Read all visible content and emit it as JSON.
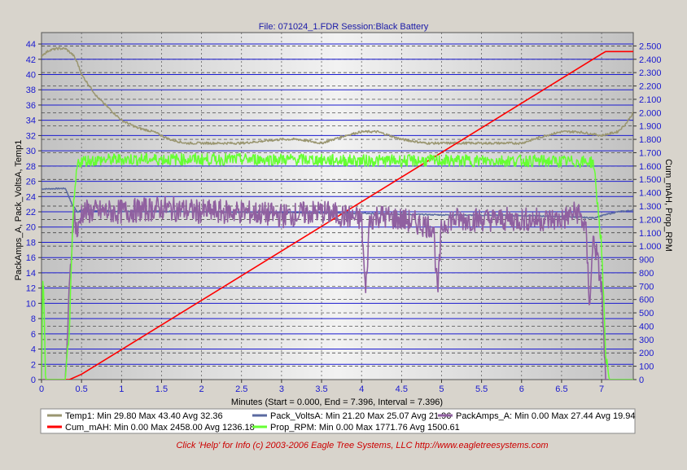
{
  "chart_data": {
    "type": "line",
    "title": "File: 071024_1.FDR   Session:Black Battery",
    "xlabel": "Minutes (Start = 0.000,  End = 7.396,  Interval =  7.396)",
    "ylabel_left": "PackAmps_A, Pack_VoltsA, Temp1",
    "ylabel_right": "Cum_mAH, Prop_RPM",
    "xlim": [
      0,
      7.396
    ],
    "ylim_left": [
      0,
      45.5
    ],
    "ylim_right": [
      0,
      2600
    ],
    "x_ticks": [
      "0",
      "0.5",
      "1",
      "1.5",
      "2",
      "2.5",
      "3",
      "3.5",
      "4",
      "4.5",
      "5",
      "5.5",
      "6",
      "6.5",
      "7"
    ],
    "y_left_ticks": [
      "0",
      "2",
      "4",
      "6",
      "8",
      "10",
      "12",
      "14",
      "16",
      "18",
      "20",
      "22",
      "24",
      "26",
      "28",
      "30",
      "32",
      "34",
      "36",
      "38",
      "40",
      "42",
      "44"
    ],
    "y_right_ticks": [
      "0",
      "100",
      "200",
      "300",
      "400",
      "500",
      "600",
      "700",
      "800",
      "900",
      "1.000",
      "1.100",
      "1.200",
      "1.300",
      "1.400",
      "1.500",
      "1.600",
      "1.700",
      "1.800",
      "1.900",
      "2.000",
      "2.100",
      "2.200",
      "2.300",
      "2.400",
      "2.500"
    ],
    "series": [
      {
        "name": "Temp1",
        "axis": "left",
        "color": "#9a9670",
        "legend": "Temp1:  Min 29.80 Max 43.40 Avg 32.36",
        "x": [
          0,
          0.1,
          0.2,
          0.3,
          0.4,
          0.45,
          0.5,
          0.6,
          0.7,
          0.8,
          0.9,
          1.0,
          1.1,
          1.2,
          1.4,
          1.6,
          1.8,
          2.0,
          2.5,
          3.0,
          3.2,
          3.5,
          3.8,
          4.0,
          4.2,
          4.5,
          4.8,
          5.0,
          5.5,
          6.0,
          6.3,
          6.5,
          6.7,
          7.0,
          7.2,
          7.3,
          7.396
        ],
        "y": [
          42.5,
          43.2,
          43.4,
          43.4,
          42.5,
          41.5,
          40.0,
          38.5,
          37.0,
          36.0,
          35.0,
          34.0,
          33.5,
          33.0,
          32.5,
          31.5,
          31.0,
          31.0,
          31.0,
          31.5,
          31.5,
          31.0,
          32.0,
          32.5,
          32.5,
          31.5,
          31.0,
          31.0,
          31.0,
          31.0,
          32.0,
          32.5,
          32.5,
          32.0,
          32.5,
          33.5,
          35.0
        ]
      },
      {
        "name": "Pack_VoltsA",
        "axis": "left",
        "color": "#5a6aa0",
        "legend": "Pack_VoltsA:  Min 21.20 Max 25.07 Avg 21.96",
        "x": [
          0,
          0.3,
          0.38,
          0.45,
          0.5,
          1.0,
          2.0,
          3.0,
          4.0,
          5.0,
          6.0,
          6.5,
          6.9,
          7.0,
          7.2,
          7.396
        ],
        "y": [
          25.0,
          25.07,
          23.0,
          22.0,
          22.2,
          22.1,
          22.0,
          21.9,
          21.8,
          21.6,
          21.5,
          21.4,
          21.2,
          21.5,
          22.0,
          22.2
        ]
      },
      {
        "name": "PackAmps_A",
        "axis": "left",
        "color": "#9060a0",
        "legend": "PackAmps_A:  Min 0.00 Max 27.44 Avg 19.94",
        "x": [
          0,
          0.3,
          0.35,
          0.4,
          0.45,
          0.5,
          1.0,
          1.5,
          2.0,
          2.5,
          3.0,
          3.5,
          4.0,
          4.05,
          4.1,
          4.2,
          4.5,
          4.9,
          4.95,
          5.0,
          5.1,
          5.5,
          6.0,
          6.5,
          6.7,
          6.8,
          6.85,
          6.9,
          7.0,
          7.05,
          7.396
        ],
        "y": [
          0,
          0,
          12,
          22,
          19,
          22,
          22,
          22.5,
          22,
          22,
          21.5,
          22,
          21,
          11,
          21,
          21.5,
          21,
          20,
          11,
          20,
          21,
          21,
          21,
          21,
          22,
          20,
          10,
          19,
          12,
          0,
          0
        ]
      },
      {
        "name": "Cum_mAH",
        "axis": "right",
        "color": "#ff0000",
        "legend": "Cum_mAH:  Min 0.00 Max 2458.00 Avg 1236.18",
        "x": [
          0,
          0.35,
          0.5,
          7.0,
          7.05,
          7.396
        ],
        "y": [
          0,
          0,
          40,
          2440,
          2458,
          2458
        ]
      },
      {
        "name": "Prop_RPM",
        "axis": "right",
        "color": "#66ff33",
        "legend": "Prop_RPM:  Min 0.00 Max 1771.76 Avg 1500.61",
        "x": [
          0,
          0.02,
          0.05,
          0.3,
          0.35,
          0.4,
          0.45,
          0.5,
          1.0,
          2.0,
          3.0,
          4.0,
          5.0,
          6.0,
          6.9,
          7.0,
          7.05,
          7.1,
          7.2,
          7.396
        ],
        "y": [
          0,
          850,
          0,
          0,
          400,
          1300,
          1620,
          1640,
          1650,
          1650,
          1650,
          1640,
          1640,
          1640,
          1630,
          1000,
          200,
          0,
          0,
          0
        ]
      }
    ]
  },
  "footer": {
    "text": "Click 'Help' for Info  (c) 2003-2006 Eagle Tree Systems, LLC     http://www.eagletreesystems.com"
  }
}
